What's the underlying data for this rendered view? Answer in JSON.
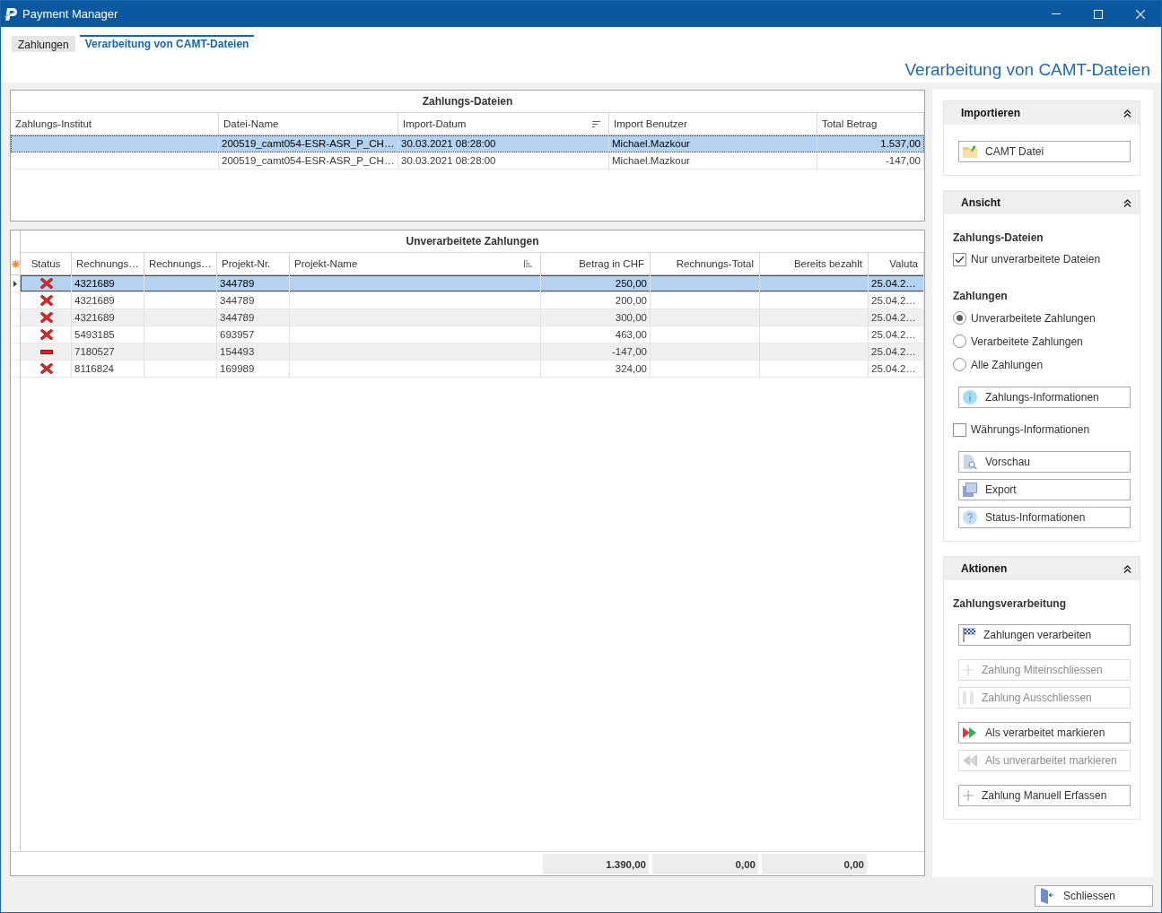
{
  "window": {
    "title": "Payment Manager"
  },
  "tabs": [
    {
      "label": "Zahlungen",
      "selected": false
    },
    {
      "label": "Verarbeitung von CAMT-Dateien",
      "selected": true
    }
  ],
  "page_title": "Verarbeitung von CAMT-Dateien",
  "files_table": {
    "title": "Zahlungs-Dateien",
    "columns": [
      {
        "label": "Zahlungs-Institut",
        "kind": "plain"
      },
      {
        "label": "Datei-Name",
        "kind": "plain"
      },
      {
        "label": "Import-Datum",
        "kind": "descending"
      },
      {
        "label": "Import Benutzer",
        "kind": "plain"
      },
      {
        "label": "Total Betrag",
        "kind": "plain"
      }
    ],
    "rows": [
      {
        "selected": true,
        "cells": [
          null,
          "200519_camt054-ESR-ASR_P_CH…",
          "30.03.2021 08:28:00",
          "Michael.Mazkour",
          "1.537,00"
        ]
      },
      {
        "selected": false,
        "cells": [
          null,
          "200519_camt054-ESR-ASR_P_CH…",
          "30.03.2021 08:28:00",
          "Michael.Mazkour",
          "-147,00"
        ]
      }
    ]
  },
  "payments_table": {
    "title": "Unverarbeitete Zahlungen",
    "columns": [
      {
        "label": "Status",
        "kind": "plain"
      },
      {
        "label": "Rechnungs…",
        "kind": "plain"
      },
      {
        "label": "Rechnungs…",
        "kind": "plain"
      },
      {
        "label": "Projekt-Nr.",
        "kind": "plain"
      },
      {
        "label": "Projekt-Name",
        "kind": "ascending"
      },
      {
        "label": "Betrag in CHF",
        "kind": "plain",
        "total": "1.390,00"
      },
      {
        "label": "Rechnungs-Total",
        "kind": "plain",
        "total": "0,00"
      },
      {
        "label": "Bereits bezahlt",
        "kind": "plain",
        "total": "0,00"
      },
      {
        "label": "Valuta",
        "kind": "plain"
      }
    ],
    "rows": [
      {
        "selected": true,
        "kind": "cross",
        "cells": [
          "4321689",
          null,
          "344789",
          null,
          "250,00",
          null,
          null,
          "25.04.2…"
        ]
      },
      {
        "selected": false,
        "kind": "cross",
        "cells": [
          "4321689",
          null,
          "344789",
          null,
          "200,00",
          null,
          null,
          "25.04.2…"
        ]
      },
      {
        "selected": false,
        "kind": "cross",
        "cells": [
          "4321689",
          null,
          "344789",
          null,
          "300,00",
          null,
          null,
          "25.04.2…"
        ]
      },
      {
        "selected": false,
        "kind": "cross",
        "cells": [
          "5493185",
          null,
          "693957",
          null,
          "463,00",
          null,
          null,
          "25.04.2…"
        ]
      },
      {
        "selected": false,
        "kind": "minus",
        "cells": [
          "7180527",
          null,
          "154493",
          null,
          "-147,00",
          null,
          null,
          "25.04.2…"
        ]
      },
      {
        "selected": false,
        "kind": "cross",
        "cells": [
          "8116824",
          null,
          "169989",
          null,
          "324,00",
          null,
          null,
          "25.04.2…"
        ]
      }
    ]
  },
  "side_panel": {
    "sections": [
      {
        "title": "Importieren",
        "expanded": true,
        "groups": [
          {
            "items": [
              {
                "kind": "button",
                "label": "CAMT Datei",
                "disabled": false
              }
            ]
          }
        ]
      },
      {
        "title": "Ansicht",
        "expanded": true,
        "groups": [
          {
            "items": [
              {
                "kind": "heading",
                "label": "Zahlungs-Dateien"
              },
              {
                "kind": "checkbox",
                "label": "Nur unverarbeitete Dateien",
                "checked": true
              }
            ]
          },
          {
            "items": [
              {
                "kind": "heading",
                "label": "Zahlungen"
              },
              {
                "kind": "radio",
                "label": "Unverarbeitete Zahlungen",
                "selected": true
              },
              {
                "kind": "radio",
                "label": "Verarbeitete Zahlungen",
                "selected": false
              },
              {
                "kind": "radio",
                "label": "Alle Zahlungen",
                "selected": false
              }
            ]
          },
          {
            "items": [
              {
                "kind": "button",
                "label": "Zahlungs-Informationen",
                "disabled": false
              }
            ]
          },
          {
            "items": [
              {
                "kind": "checkbox",
                "label": "Währungs-Informationen",
                "checked": false
              }
            ]
          },
          {
            "items": [
              {
                "kind": "button",
                "label": "Vorschau",
                "disabled": false
              },
              {
                "kind": "button",
                "label": "Export",
                "disabled": false
              },
              {
                "kind": "button",
                "label": "Status-Informationen",
                "disabled": false
              }
            ]
          }
        ]
      },
      {
        "title": "Aktionen",
        "expanded": true,
        "groups": [
          {
            "items": [
              {
                "kind": "heading",
                "label": "Zahlungsverarbeitung"
              }
            ]
          },
          {
            "items": [
              {
                "kind": "button",
                "label": "Zahlungen verarbeiten",
                "disabled": false
              }
            ]
          },
          {
            "items": [
              {
                "kind": "button",
                "label": "Zahlung Miteinschliessen",
                "disabled": true
              },
              {
                "kind": "button",
                "label": "Zahlung Ausschliessen",
                "disabled": true
              }
            ]
          },
          {
            "items": [
              {
                "kind": "button",
                "label": "Als verarbeitet markieren",
                "disabled": false
              },
              {
                "kind": "button",
                "label": "Als unverarbeitet markieren",
                "disabled": true
              }
            ]
          },
          {
            "items": [
              {
                "kind": "button",
                "label": "Zahlung Manuell Erfassen",
                "disabled": false
              }
            ]
          }
        ]
      }
    ]
  },
  "close_button": {
    "label": "Schliessen"
  }
}
